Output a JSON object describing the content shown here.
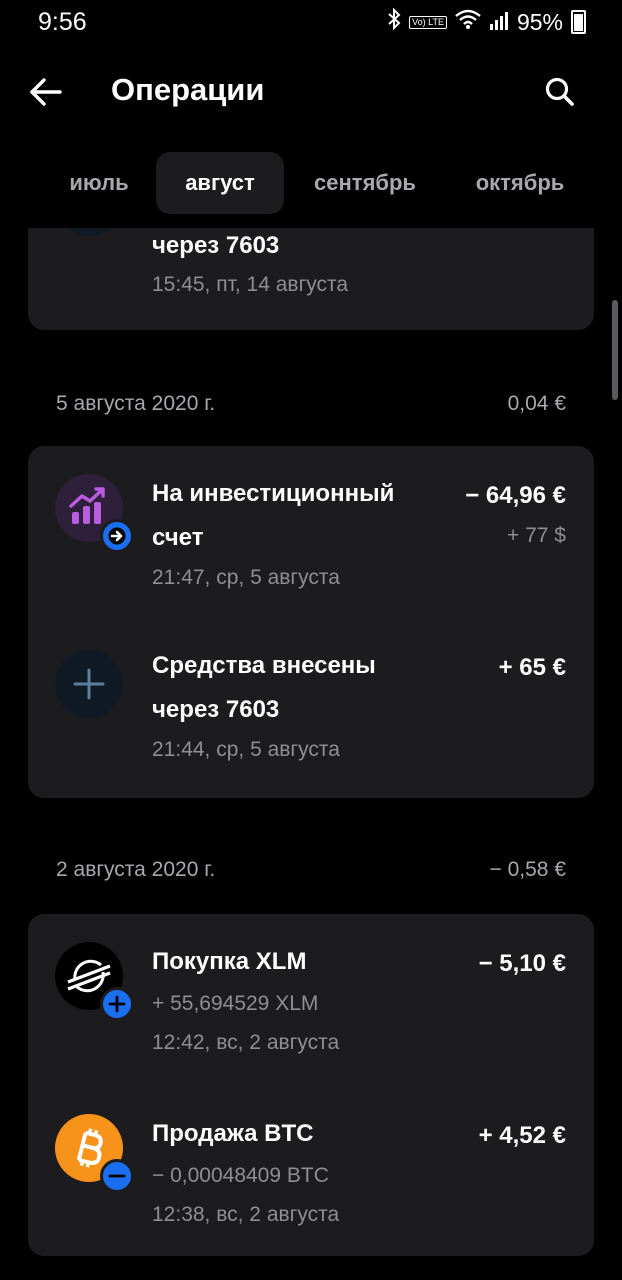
{
  "status": {
    "time": "9:56",
    "volte": "Vo) LTE",
    "battery": "95%"
  },
  "header": {
    "title": "Операции"
  },
  "tabs": [
    {
      "label": "июль"
    },
    {
      "label": "август",
      "active": true
    },
    {
      "label": "сентябрь"
    },
    {
      "label": "октябрь"
    }
  ],
  "partial_card": {
    "title_tail": "через 7603",
    "time": "15:45, пт, 14 августа"
  },
  "groups": [
    {
      "date": "5 августа 2020 г.",
      "total": "0,04 €",
      "items": [
        {
          "title_line1": "На инвестиционный",
          "title_line2": "счет",
          "amount": "− 64,96 €",
          "amount2": "+ 77 $",
          "time": "21:47, ср, 5 августа",
          "icon": "investment-chart-icon",
          "badge": "arrow-right-icon"
        },
        {
          "title_line1": "Средства внесены",
          "title_line2": "через 7603",
          "amount": "+ 65 €",
          "time": "21:44, ср, 5 августа",
          "icon": "plus-icon"
        }
      ]
    },
    {
      "date": "2 августа 2020 г.",
      "total": "− 0,58 €",
      "items": [
        {
          "title_line1": "Покупка XLM",
          "sub": "+ 55,694529 XLM",
          "amount": "− 5,10 €",
          "time": "12:42, вс, 2 августа",
          "icon": "stellar-icon",
          "badge": "plus-badge-icon"
        },
        {
          "title_line1": "Продажа BTC",
          "sub": "− 0,00048409 BTC",
          "amount": "+ 4,52 €",
          "time": "12:38, вс, 2 августа",
          "icon": "bitcoin-icon",
          "badge": "minus-badge-icon"
        }
      ]
    }
  ],
  "colors": {
    "background": "#000000",
    "card": "#1c1c1e",
    "accent": "#1a6ef0",
    "muted": "#8e8e93",
    "bitcoin": "#f7931a",
    "investment": "#b95de0"
  }
}
